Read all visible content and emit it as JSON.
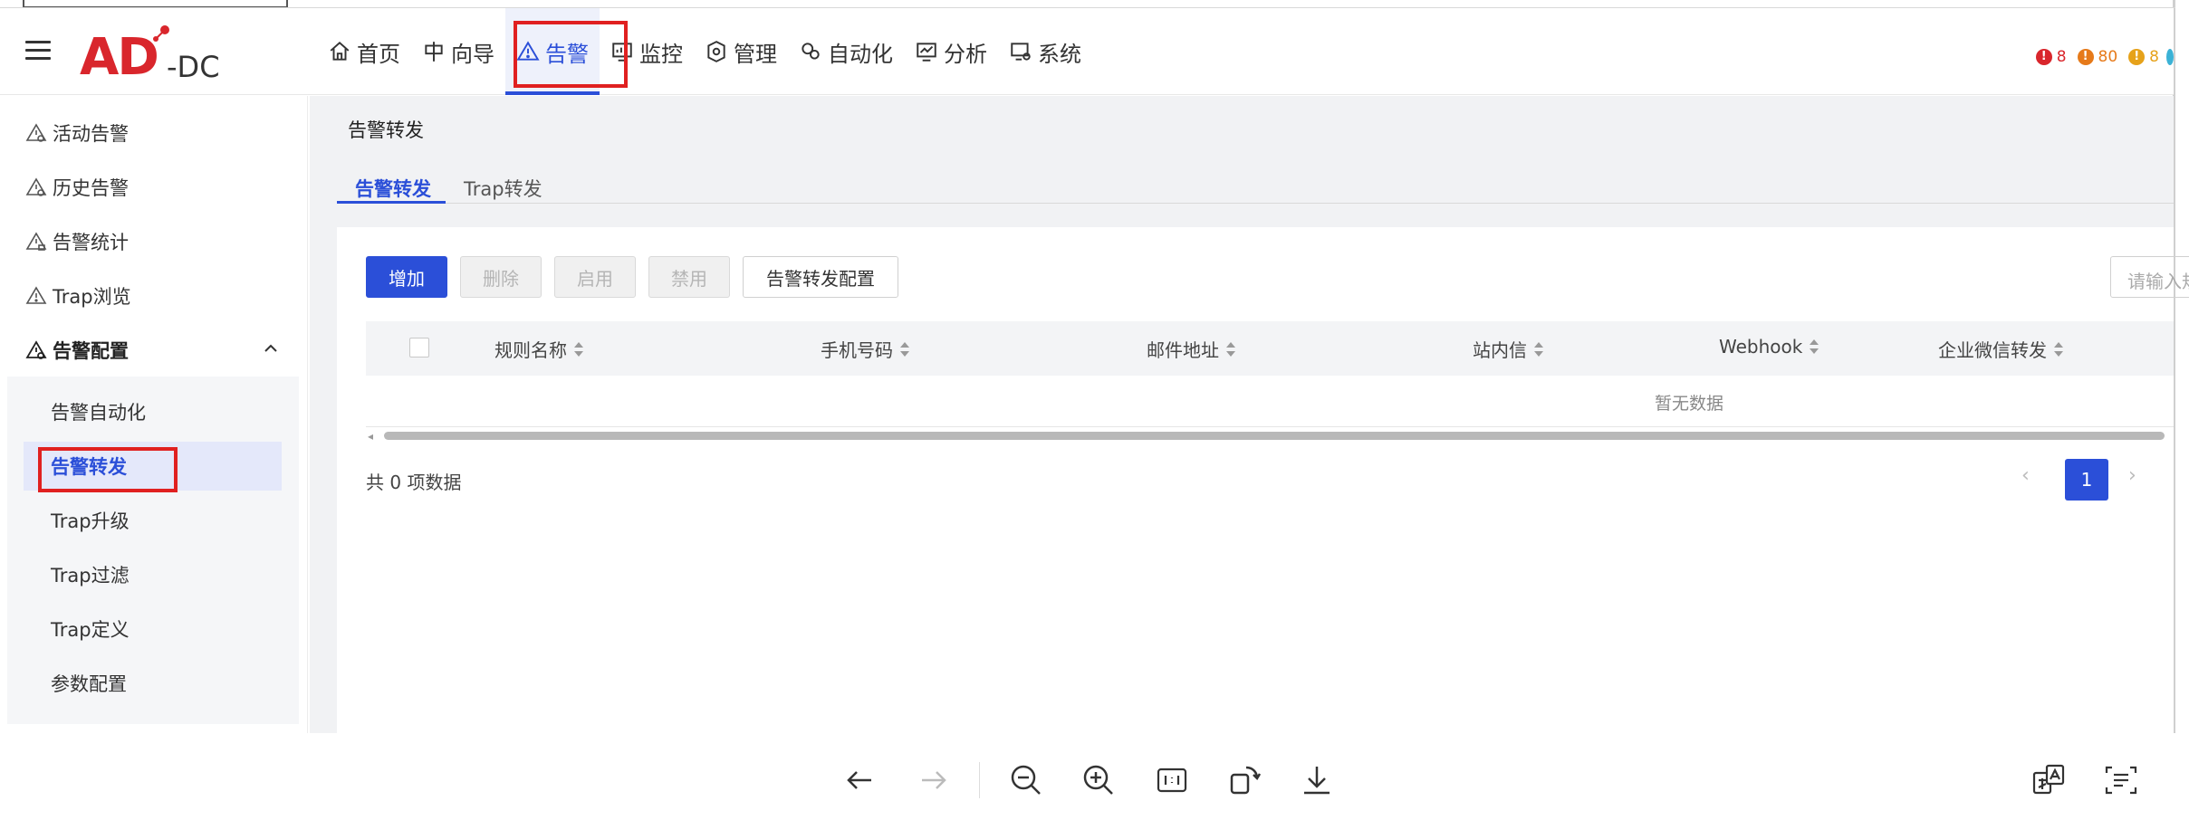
{
  "header": {
    "logo_main": "AD",
    "logo_suffix": "-DC",
    "nav": [
      {
        "label": "首页",
        "icon": "home-icon"
      },
      {
        "label": "向导",
        "icon": "guide-icon"
      },
      {
        "label": "告警",
        "icon": "warning-icon",
        "active": true
      },
      {
        "label": "监控",
        "icon": "monitor-icon"
      },
      {
        "label": "管理",
        "icon": "manage-icon"
      },
      {
        "label": "自动化",
        "icon": "automation-icon"
      },
      {
        "label": "分析",
        "icon": "analysis-icon"
      },
      {
        "label": "系统",
        "icon": "system-icon"
      }
    ],
    "badges": [
      {
        "count": "8",
        "color": "#d9262c"
      },
      {
        "count": "80",
        "color": "#e67a1a"
      },
      {
        "count": "8",
        "color": "#e6a21a"
      }
    ]
  },
  "sidebar": {
    "items": [
      "活动告警",
      "历史告警",
      "告警统计",
      "Trap浏览"
    ],
    "group": "告警配置",
    "sub_items": [
      "告警自动化",
      "告警转发",
      "Trap升级",
      "Trap过滤",
      "Trap定义",
      "参数配置"
    ],
    "active_sub": "告警转发"
  },
  "main": {
    "title": "告警转发",
    "tabs": [
      "告警转发",
      "Trap转发"
    ],
    "buttons": {
      "add": "增加",
      "delete": "删除",
      "enable": "启用",
      "disable": "禁用",
      "config": "告警转发配置"
    },
    "search_placeholder": "请输入规则名称",
    "columns": [
      "规则名称",
      "手机号码",
      "邮件地址",
      "站内信",
      "Webhook",
      "企业微信转发"
    ],
    "empty_text": "暂无数据",
    "total_text": "共 0 项数据",
    "current_page": "1"
  },
  "colors": {
    "accent": "#2b4fd8",
    "brand": "#d9262c",
    "highlight_box": "#e02020"
  }
}
